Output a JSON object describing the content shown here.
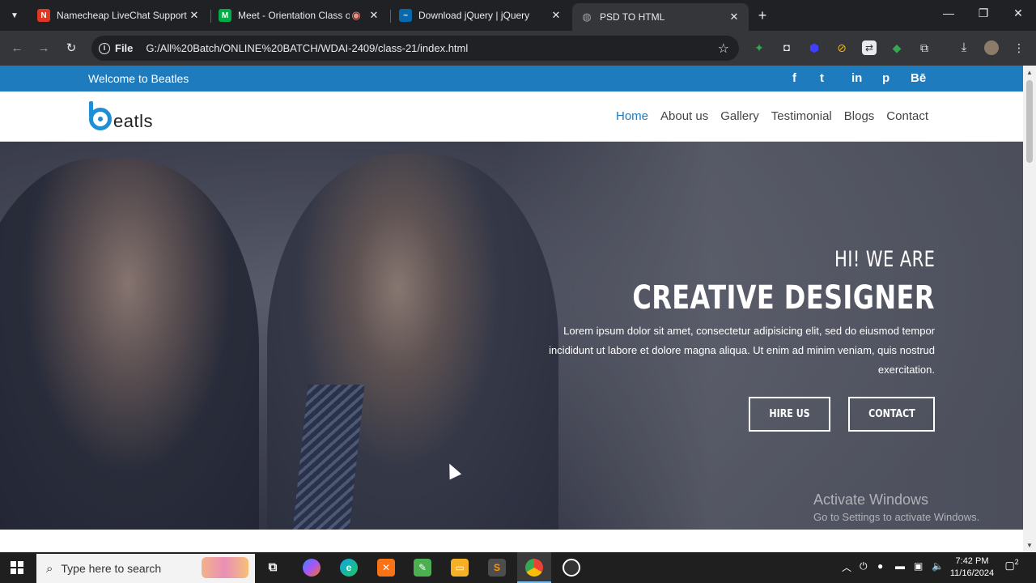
{
  "browser": {
    "tabs": [
      {
        "title": "Namecheap LiveChat Support -",
        "favicon": "namecheap-icon",
        "color": "#de3723"
      },
      {
        "title": "Meet - Orientation Class of",
        "favicon": "meet-icon",
        "color": "#00ac47"
      },
      {
        "title": "Download jQuery | jQuery",
        "favicon": "jquery-icon",
        "color": "#0769ad"
      },
      {
        "title": "PSD TO HTML",
        "favicon": "globe-icon",
        "color": "#9aa0a6"
      }
    ],
    "new_tab": "+",
    "address": {
      "scheme": "File",
      "url": "G:/All%20Batch/ONLINE%20BATCH/WDAI-2409/class-21/index.html"
    },
    "window_controls": {
      "minimize": "—",
      "restore": "❐",
      "close": "✕"
    }
  },
  "page": {
    "topbar": {
      "welcome": "Welcome to Beatles",
      "social": [
        "f",
        "t",
        "in",
        "p",
        "Bē"
      ]
    },
    "logo": {
      "word": "eatls"
    },
    "menu": [
      "Home",
      "About us",
      "Gallery",
      "Testimonial",
      "Blogs",
      "Contact"
    ],
    "hero": {
      "subtitle": "HI! WE ARE",
      "headline": "CREATIVE DESIGNER",
      "paragraph": "Lorem ipsum dolor sit amet, consectetur adipisicing elit, sed do eiusmod tempor incididunt ut labore et dolore magna aliqua. Ut enim ad minim veniam, quis nostrud exercitation.",
      "button_hire": "HIRE US",
      "button_contact": "CONTACT"
    },
    "watermark": {
      "line1": "Activate Windows",
      "line2": "Go to Settings to activate Windows."
    }
  },
  "taskbar": {
    "search_placeholder": "Type here to search",
    "time": "7:42 PM",
    "date": "11/16/2024",
    "notifications": "2"
  },
  "colors": {
    "brand": "#1e7bbd",
    "logo": "#1e8fd6"
  }
}
